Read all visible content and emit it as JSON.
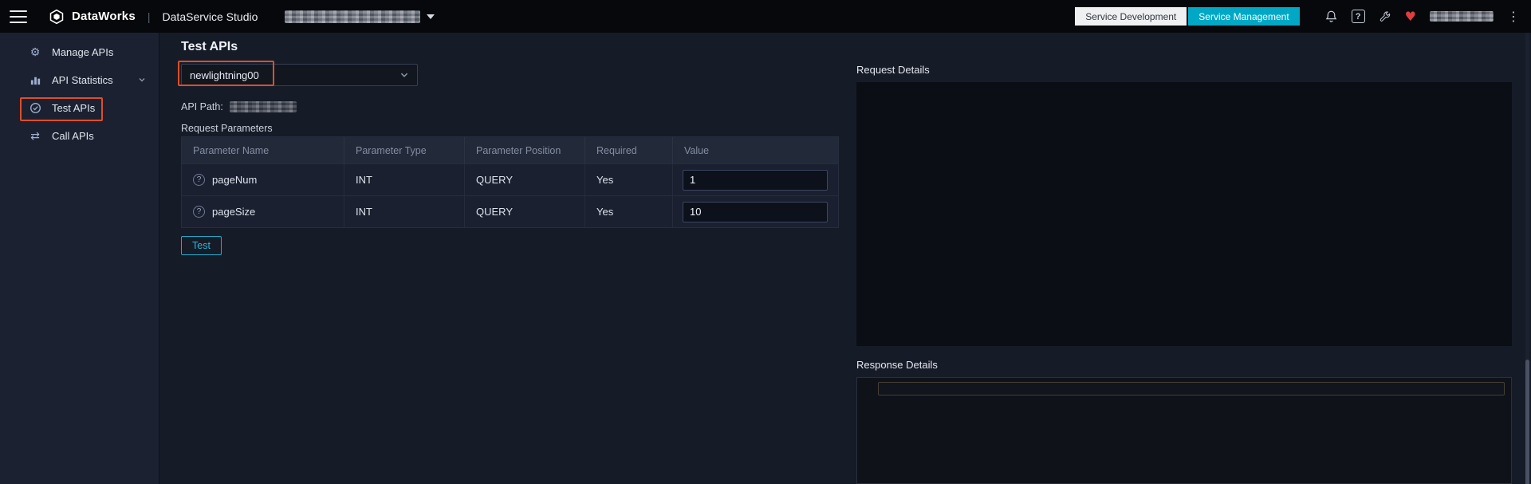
{
  "topbar": {
    "product": "DataWorks",
    "separator": "|",
    "module": "DataService Studio",
    "nav": [
      {
        "label": "Service Development",
        "active": false
      },
      {
        "label": "Service Management",
        "active": true
      }
    ]
  },
  "sidebar": {
    "items": [
      {
        "label": "Manage APIs"
      },
      {
        "label": "API Statistics"
      },
      {
        "label": "Test APIs"
      },
      {
        "label": "Call APIs"
      }
    ]
  },
  "main": {
    "title": "Test APIs",
    "api_select": {
      "value": "newlightning00"
    },
    "api_path_label": "API Path:",
    "request_parameters_label": "Request Parameters",
    "table": {
      "headers": [
        "Parameter Name",
        "Parameter Type",
        "Parameter Position",
        "Required",
        "Value"
      ],
      "rows": [
        {
          "name": "pageNum",
          "type": "INT",
          "position": "QUERY",
          "required": "Yes",
          "value": "1"
        },
        {
          "name": "pageSize",
          "type": "INT",
          "position": "QUERY",
          "required": "Yes",
          "value": "10"
        }
      ]
    },
    "test_button_label": "Test"
  },
  "right": {
    "request_details_title": "Request Details",
    "response_details_title": "Response Details"
  },
  "glyphs": {
    "gear": "⚙",
    "swap_arrows": "⇄",
    "heart": "♥",
    "more_vertical": "⋮",
    "help": "?",
    "row_help": "?"
  },
  "colors": {
    "accent_cyan": "#00a8c6",
    "annotation_orange": "#dd4f27",
    "heart_red": "#e23c3c"
  }
}
